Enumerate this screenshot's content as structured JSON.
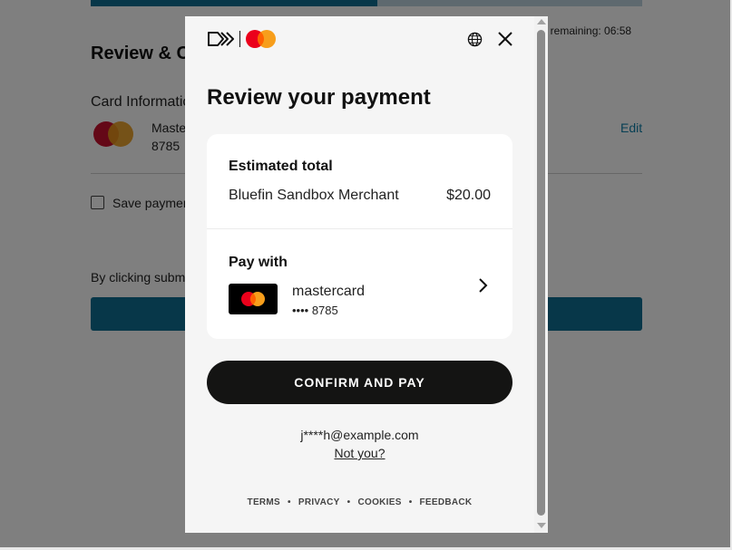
{
  "background": {
    "progress_fraction": 0.52,
    "time_remaining": "ne remaining: 06:58",
    "title": "Review & Co",
    "card_info_label": "Card Informatio",
    "card_name": "Maste",
    "card_last4": "8785",
    "edit_label": "Edit",
    "save_label": "Save paymen",
    "terms_text": "By clicking subm"
  },
  "modal": {
    "title": "Review your payment",
    "summary": {
      "estimated_total_label": "Estimated total",
      "merchant": "Bluefin Sandbox Merchant",
      "amount": "$20.00"
    },
    "pay_with": {
      "label": "Pay with",
      "card_brand": "mastercard",
      "card_number": "•••• 8785"
    },
    "confirm_label": "CONFIRM AND PAY",
    "email": "j****h@example.com",
    "not_you": "Not you?",
    "footer_links": [
      "TERMS",
      "PRIVACY",
      "COOKIES",
      "FEEDBACK"
    ]
  },
  "icons": {
    "brand": "click-to-pay-icon",
    "card_logo": "mastercard-logo-icon",
    "language": "globe-icon",
    "close": "close-icon",
    "chevron": "chevron-right-icon"
  },
  "colors": {
    "primary_button": "#141413",
    "page_accent": "#0e6f93",
    "mastercard_red": "#eb001b",
    "mastercard_orange": "#f79e1b",
    "modal_background": "#f5f5f5"
  }
}
